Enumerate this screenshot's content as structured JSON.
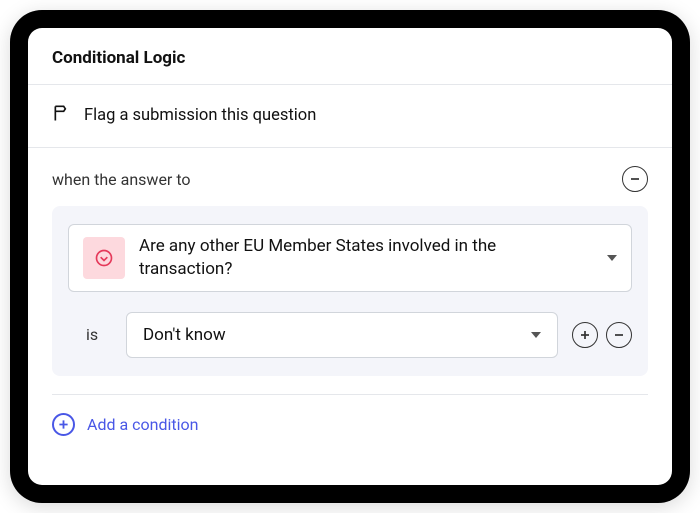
{
  "header": {
    "title": "Conditional Logic"
  },
  "flag": {
    "text": "Flag a submission this question"
  },
  "condition": {
    "whenLabel": "when the answer to",
    "question": "Are any other EU Member States involved in the transaction?",
    "operator": "is",
    "answer": "Don't know"
  },
  "addCondition": {
    "label": "Add a condition"
  },
  "colors": {
    "accent": "#4957e6",
    "badgeBg": "#fdd9de",
    "badgeFg": "#e5395a"
  }
}
